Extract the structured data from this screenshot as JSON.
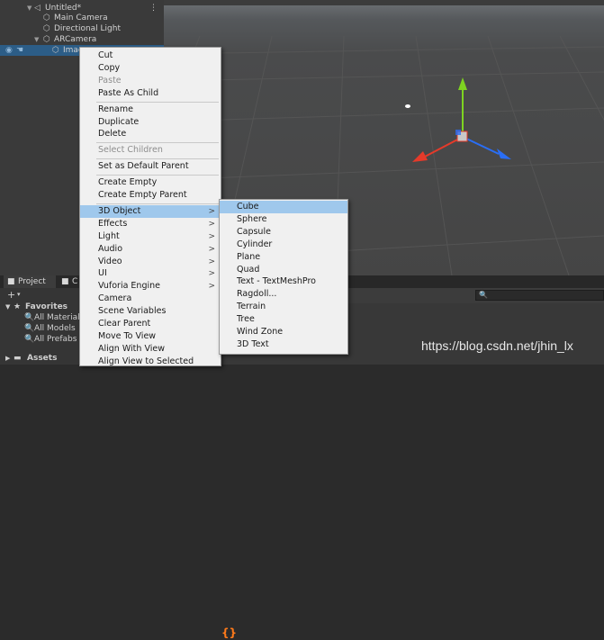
{
  "hierarchy": {
    "scene_name": "Untitled*",
    "items": [
      {
        "label": "Main Camera"
      },
      {
        "label": "Directional Light"
      },
      {
        "label": "ARCamera"
      },
      {
        "label": "Imag"
      }
    ]
  },
  "context_menu": {
    "items": [
      {
        "label": "Cut",
        "disabled": false
      },
      {
        "label": "Copy",
        "disabled": false
      },
      {
        "label": "Paste",
        "disabled": true
      },
      {
        "label": "Paste As Child",
        "disabled": false
      },
      {
        "label": "Rename",
        "disabled": false
      },
      {
        "label": "Duplicate",
        "disabled": false
      },
      {
        "label": "Delete",
        "disabled": false
      },
      {
        "label": "Select Children",
        "disabled": true
      },
      {
        "label": "Set as Default Parent",
        "disabled": false
      },
      {
        "label": "Create Empty",
        "disabled": false
      },
      {
        "label": "Create Empty Parent",
        "disabled": false
      },
      {
        "label": "3D Object",
        "disabled": false,
        "submenu": true,
        "highlighted": true
      },
      {
        "label": "Effects",
        "disabled": false,
        "submenu": true
      },
      {
        "label": "Light",
        "disabled": false,
        "submenu": true
      },
      {
        "label": "Audio",
        "disabled": false,
        "submenu": true
      },
      {
        "label": "Video",
        "disabled": false,
        "submenu": true
      },
      {
        "label": "UI",
        "disabled": false,
        "submenu": true
      },
      {
        "label": "Vuforia Engine",
        "disabled": false,
        "submenu": true
      },
      {
        "label": "Camera",
        "disabled": false
      },
      {
        "label": "Scene Variables",
        "disabled": false
      },
      {
        "label": "Clear Parent",
        "disabled": false
      },
      {
        "label": "Move To View",
        "disabled": false
      },
      {
        "label": "Align With View",
        "disabled": false
      },
      {
        "label": "Align View to Selected",
        "disabled": false
      }
    ],
    "submenu_arrow": ">"
  },
  "submenu_3d_object": {
    "items": [
      {
        "label": "Cube",
        "highlighted": true
      },
      {
        "label": "Sphere"
      },
      {
        "label": "Capsule"
      },
      {
        "label": "Cylinder"
      },
      {
        "label": "Plane"
      },
      {
        "label": "Quad"
      },
      {
        "label": "Text - TextMeshPro"
      },
      {
        "label": "Ragdoll..."
      },
      {
        "label": "Terrain"
      },
      {
        "label": "Tree"
      },
      {
        "label": "Wind Zone"
      },
      {
        "label": "3D Text"
      }
    ]
  },
  "bottom_panel": {
    "tabs": [
      {
        "label": "Project"
      },
      {
        "label": "C"
      }
    ],
    "add_symbol": "+",
    "favorites_label": "Favorites",
    "favorites_items": [
      {
        "label": "All Materials"
      },
      {
        "label": "All Models"
      },
      {
        "label": "All Prefabs"
      }
    ],
    "assets_label": "Assets"
  },
  "watermark": "https://blog.csdn.net/jhin_lx",
  "colors": {
    "menu_bg": "#f0f0f0",
    "menu_highlight": "#9fc8ec",
    "selection": "#2c5d87",
    "gizmo_y": "#7ed321",
    "gizmo_x": "#e53a2a",
    "gizmo_z": "#2a6ef5"
  }
}
